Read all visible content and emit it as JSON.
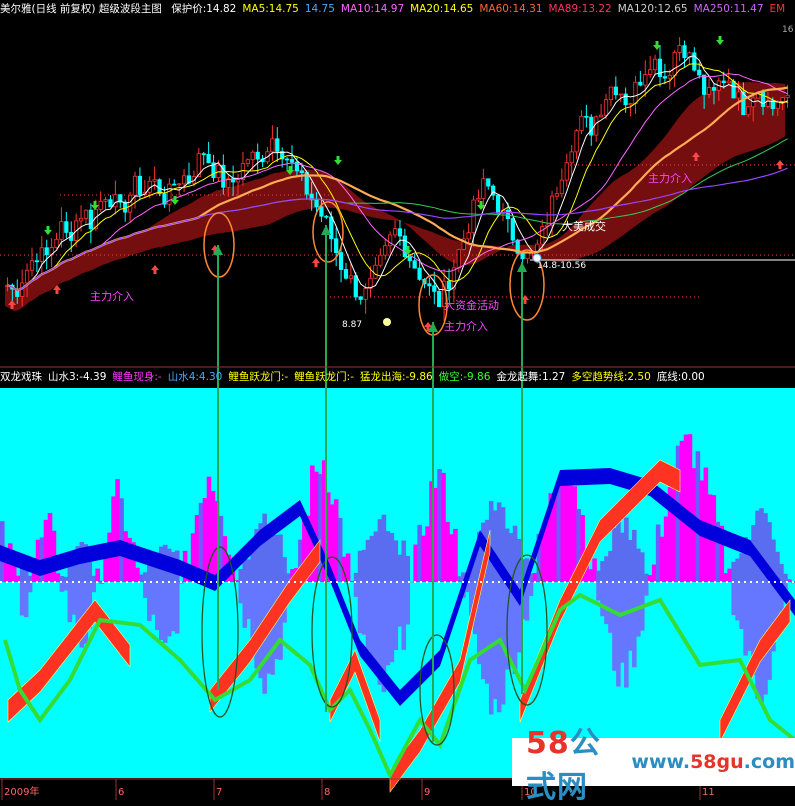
{
  "top_header": {
    "title": "美尔雅(日线 前复权) 超级波段主图",
    "items": [
      {
        "label": "保护价:14.82",
        "color": "#ffffff"
      },
      {
        "label": "MA5:14.75",
        "color": "#ffff00"
      },
      {
        "label": "14.75",
        "color": "#4aa8ff"
      },
      {
        "label": "MA10:14.97",
        "color": "#ff66ff"
      },
      {
        "label": "MA20:14.65",
        "color": "#ffff00"
      },
      {
        "label": "MA60:14.31",
        "color": "#ff6633"
      },
      {
        "label": "MA89:13.22",
        "color": "#ff3366"
      },
      {
        "label": "MA120:12.65",
        "color": "#cccccc"
      },
      {
        "label": "MA250:11.47",
        "color": "#cc66ff"
      },
      {
        "label": "EM",
        "color": "#ff3333"
      }
    ],
    "right_value": "16"
  },
  "bottom_header": {
    "items": [
      {
        "label": "双龙戏珠",
        "color": "#ffffff"
      },
      {
        "label": "山水3:-4.39",
        "color": "#ffffff"
      },
      {
        "label": "鲤鱼现身:-",
        "color": "#ff33ff"
      },
      {
        "label": "山水4:4.30",
        "color": "#4aa8ff"
      },
      {
        "label": "鲤鱼跃龙门:-",
        "color": "#ffff00"
      },
      {
        "label": "鲤鱼跃龙门:-",
        "color": "#ffff00"
      },
      {
        "label": "猛龙出海:-9.86",
        "color": "#ffff00"
      },
      {
        "label": "做空:-9.86",
        "color": "#33ff33"
      },
      {
        "label": "金龙起舞:1.27",
        "color": "#ffffff"
      },
      {
        "label": "多空趋势线:2.50",
        "color": "#ffff00"
      },
      {
        "label": "底线:0.00",
        "color": "#ffffff"
      }
    ]
  },
  "annotations": {
    "zhuli1": "主力介入",
    "zhuli2": "主力介入",
    "zhuli3": "主力介入",
    "dazi": "大资金活动",
    "dayuan": "大美成交",
    "price_low": "8.87",
    "price_mark": "14.8-10.56"
  },
  "x_axis_labels": [
    "2009年",
    "6",
    "7",
    "8",
    "9",
    "10",
    "11"
  ],
  "watermark": {
    "text_a": "58",
    "text_b": "公式网",
    "url_a": "www.",
    "url_b": "58gu",
    "url_c": ".com"
  },
  "colors": {
    "up": "#ff3333",
    "down": "#00ffff",
    "cyan_bg": "#00ffff",
    "magenta": "#ff00ff",
    "red_band": "#ff3322",
    "blue_band": "#0000dd",
    "green_line": "#33dd33",
    "ellipse": "#ff8833",
    "arrow_green": "#22aa55"
  },
  "chart_data": {
    "type": "candlestick",
    "ylim": [
      8.5,
      16.5
    ],
    "n_bars": 160,
    "close_path": [
      10.4,
      10.2,
      10.6,
      10.9,
      11.2,
      11.0,
      11.4,
      11.8,
      11.5,
      11.9,
      12.2,
      11.9,
      12.3,
      12.6,
      12.4,
      12.1,
      12.5,
      12.8,
      12.6,
      12.9,
      12.7,
      12.4,
      12.8,
      13.0,
      12.9,
      13.3,
      13.6,
      13.2,
      13.0,
      12.7,
      12.9,
      13.2,
      13.5,
      13.3,
      13.6,
      13.9,
      13.7,
      13.4,
      13.1,
      12.8,
      12.5,
      12.2,
      11.9,
      11.4,
      10.9,
      10.6,
      10.3,
      10.1,
      10.4,
      10.8,
      11.2,
      11.7,
      11.5,
      11.1,
      10.8,
      10.5,
      10.2,
      10.0,
      10.4,
      10.9,
      11.4,
      11.9,
      12.4,
      12.8,
      12.6,
      12.2,
      11.8,
      11.5,
      11.2,
      11.0,
      11.3,
      11.8,
      12.4,
      13.0,
      13.6,
      14.0,
      14.3,
      14.1,
      14.5,
      14.9,
      15.2,
      15.0,
      14.7,
      15.1,
      15.5,
      15.8,
      15.6,
      15.3,
      15.9,
      16.2,
      15.8,
      15.4,
      15.0,
      14.8,
      15.2,
      15.4,
      15.0,
      14.6,
      14.9,
      15.1,
      14.8,
      14.6,
      14.9,
      14.7
    ],
    "volume_osc_path": [
      0.3,
      0.1,
      -0.2,
      0.2,
      0.4,
      0.1,
      -0.3,
      -0.5,
      -0.2,
      0.3,
      0.6,
      0.4,
      0.0,
      -0.3,
      -0.6,
      -0.4,
      0.1,
      0.5,
      0.8,
      0.6,
      0.2,
      -0.2,
      -0.5,
      -0.8,
      -0.6,
      -0.2,
      0.3,
      0.7,
      0.9,
      0.6,
      0.2,
      -0.3,
      -0.6,
      -0.9,
      -0.7,
      -0.4,
      0.1,
      0.5,
      0.8,
      0.5,
      0.1,
      -0.4,
      -0.8,
      -1.0,
      -0.8,
      -0.5,
      -0.1,
      0.3,
      0.6,
      0.9,
      0.7,
      0.3,
      -0.1,
      -0.5,
      -0.8,
      -0.6,
      -0.2,
      0.2,
      0.6,
      0.9,
      1.0,
      0.8,
      0.5,
      0.2,
      -0.2,
      -0.6,
      -0.9,
      -0.7,
      -0.3,
      0.1
    ]
  }
}
